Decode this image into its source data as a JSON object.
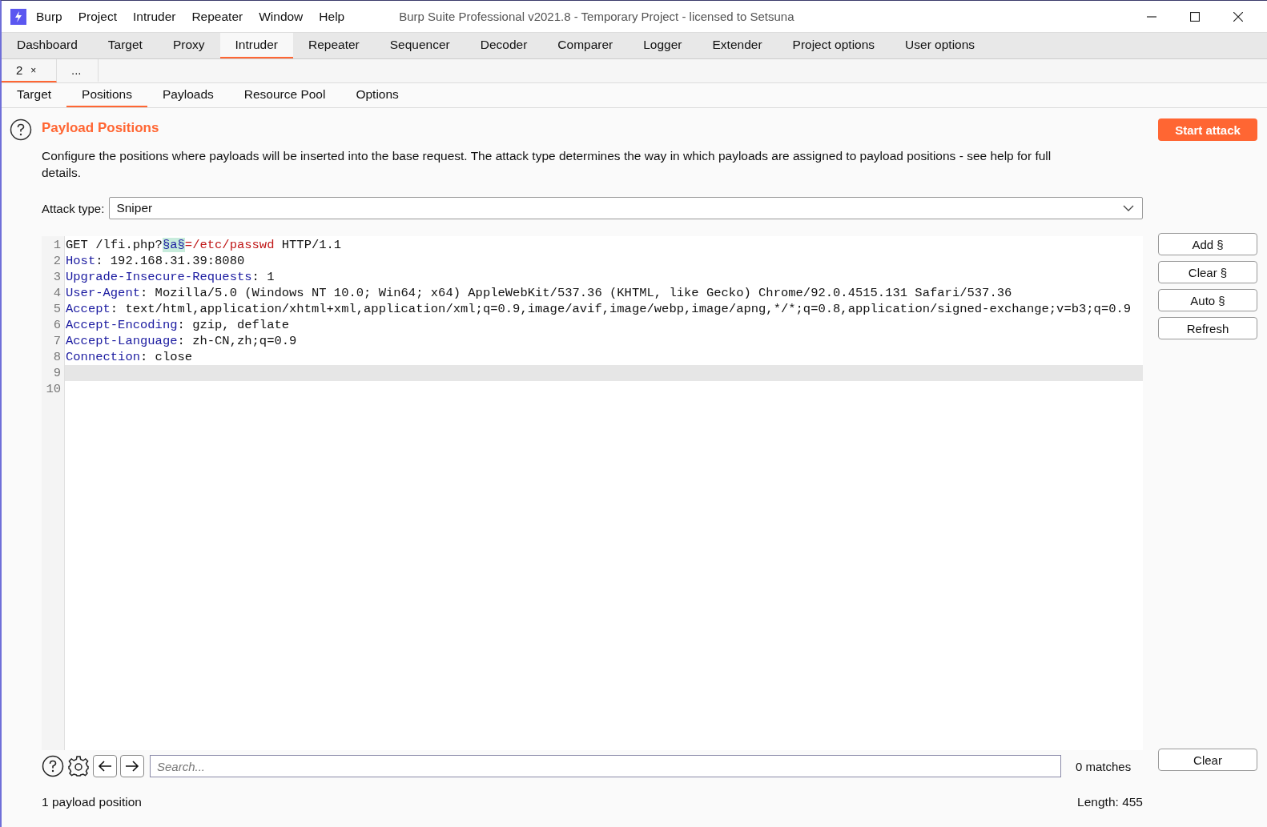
{
  "window": {
    "title": "Burp Suite Professional v2021.8 - Temporary Project - licensed to Setsuna"
  },
  "menu": [
    "Burp",
    "Project",
    "Intruder",
    "Repeater",
    "Window",
    "Help"
  ],
  "main_tabs": [
    {
      "label": "Dashboard",
      "selected": false
    },
    {
      "label": "Target",
      "selected": false
    },
    {
      "label": "Proxy",
      "selected": false
    },
    {
      "label": "Intruder",
      "selected": true
    },
    {
      "label": "Repeater",
      "selected": false
    },
    {
      "label": "Sequencer",
      "selected": false
    },
    {
      "label": "Decoder",
      "selected": false
    },
    {
      "label": "Comparer",
      "selected": false
    },
    {
      "label": "Logger",
      "selected": false
    },
    {
      "label": "Extender",
      "selected": false
    },
    {
      "label": "Project options",
      "selected": false
    },
    {
      "label": "User options",
      "selected": false
    }
  ],
  "instance_tabs": [
    {
      "label": "2",
      "close": "×",
      "selected": true
    },
    {
      "label": "...",
      "selected": false
    }
  ],
  "sub_tabs": [
    {
      "label": "Target",
      "selected": false
    },
    {
      "label": "Positions",
      "selected": true
    },
    {
      "label": "Payloads",
      "selected": false
    },
    {
      "label": "Resource Pool",
      "selected": false
    },
    {
      "label": "Options",
      "selected": false
    }
  ],
  "panel": {
    "title": "Payload Positions",
    "description": "Configure the positions where payloads will be inserted into the base request. The attack type determines the way in which payloads are assigned to payload positions - see help for full details.",
    "start_button": "Start attack",
    "attack_type_label": "Attack type:",
    "attack_type": "Sniper"
  },
  "editor": {
    "lines": [
      {
        "number": "1",
        "current": false,
        "segments": [
          {
            "kind": "plain",
            "text": "GET /lfi.php?"
          },
          {
            "kind": "marker",
            "text": "§a§"
          },
          {
            "kind": "param",
            "text": "=/etc/passwd"
          },
          {
            "kind": "plain",
            "text": " HTTP/1.1"
          }
        ]
      },
      {
        "number": "2",
        "current": false,
        "segments": [
          {
            "kind": "header",
            "text": "Host"
          },
          {
            "kind": "plain",
            "text": ": 192.168.31.39:8080"
          }
        ]
      },
      {
        "number": "3",
        "current": false,
        "segments": [
          {
            "kind": "header",
            "text": "Upgrade-Insecure-Requests"
          },
          {
            "kind": "plain",
            "text": ": 1"
          }
        ]
      },
      {
        "number": "4",
        "current": false,
        "segments": [
          {
            "kind": "header",
            "text": "User-Agent"
          },
          {
            "kind": "plain",
            "text": ": Mozilla/5.0 (Windows NT 10.0; Win64; x64) AppleWebKit/537.36 (KHTML, like Gecko) Chrome/92.0.4515.131 Safari/537.36"
          }
        ]
      },
      {
        "number": "5",
        "current": false,
        "segments": [
          {
            "kind": "header",
            "text": "Accept"
          },
          {
            "kind": "plain",
            "text": ": text/html,application/xhtml+xml,application/xml;q=0.9,image/avif,image/webp,image/apng,*/*;q=0.8,application/signed-exchange;v=b3;q=0.9"
          }
        ]
      },
      {
        "number": "6",
        "current": false,
        "segments": [
          {
            "kind": "header",
            "text": "Accept-Encoding"
          },
          {
            "kind": "plain",
            "text": ": gzip, deflate"
          }
        ]
      },
      {
        "number": "7",
        "current": false,
        "segments": [
          {
            "kind": "header",
            "text": "Accept-Language"
          },
          {
            "kind": "plain",
            "text": ": zh-CN,zh;q=0.9"
          }
        ]
      },
      {
        "number": "8",
        "current": false,
        "segments": [
          {
            "kind": "header",
            "text": "Connection"
          },
          {
            "kind": "plain",
            "text": ": close"
          }
        ]
      },
      {
        "number": "9",
        "current": true
      },
      {
        "number": "10",
        "current": false
      }
    ]
  },
  "side_buttons": [
    "Add §",
    "Clear §",
    "Auto §",
    "Refresh"
  ],
  "search": {
    "placeholder": "Search...",
    "matches": "0 matches",
    "clear": "Clear"
  },
  "status": {
    "positions": "1 payload position",
    "length": "Length: 455"
  }
}
